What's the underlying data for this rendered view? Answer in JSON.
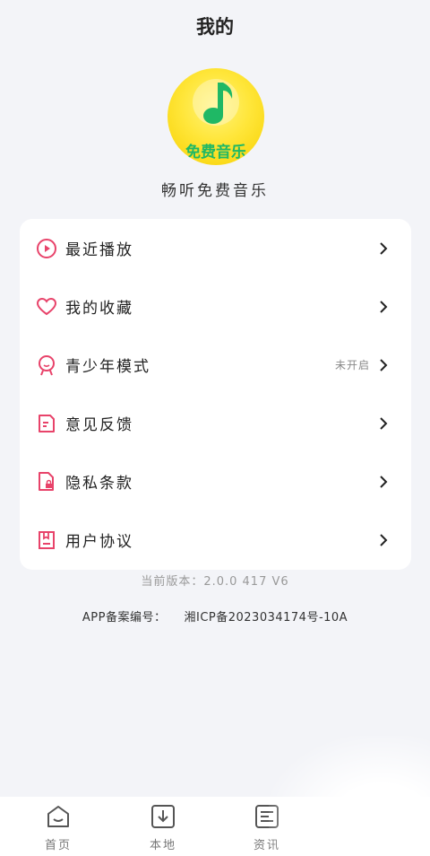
{
  "header": {
    "title": "我的"
  },
  "app": {
    "logo_text": "免费音乐",
    "slogan": "畅听免费音乐",
    "logo_color": "#ffe63a",
    "logo_text_color": "#1fb865"
  },
  "menu": {
    "items": [
      {
        "label": "最近播放",
        "icon": "play-circle-icon",
        "status": ""
      },
      {
        "label": "我的收藏",
        "icon": "heart-icon",
        "status": ""
      },
      {
        "label": "青少年模式",
        "icon": "youth-mode-icon",
        "status": "未开启"
      },
      {
        "label": "意见反馈",
        "icon": "feedback-icon",
        "status": ""
      },
      {
        "label": "隐私条款",
        "icon": "privacy-icon",
        "status": ""
      },
      {
        "label": "用户协议",
        "icon": "agreement-icon",
        "status": ""
      }
    ],
    "icon_color": "#e8436a"
  },
  "footer": {
    "version": "当前版本：2.0.0 417 V6",
    "icp_label": "APP备案编号：",
    "icp_number": "湘ICP备2023034174号-10A"
  },
  "tabbar": {
    "tabs": [
      {
        "label": "首页",
        "icon": "home-icon"
      },
      {
        "label": "本地",
        "icon": "download-icon"
      },
      {
        "label": "资讯",
        "icon": "news-icon"
      }
    ]
  }
}
